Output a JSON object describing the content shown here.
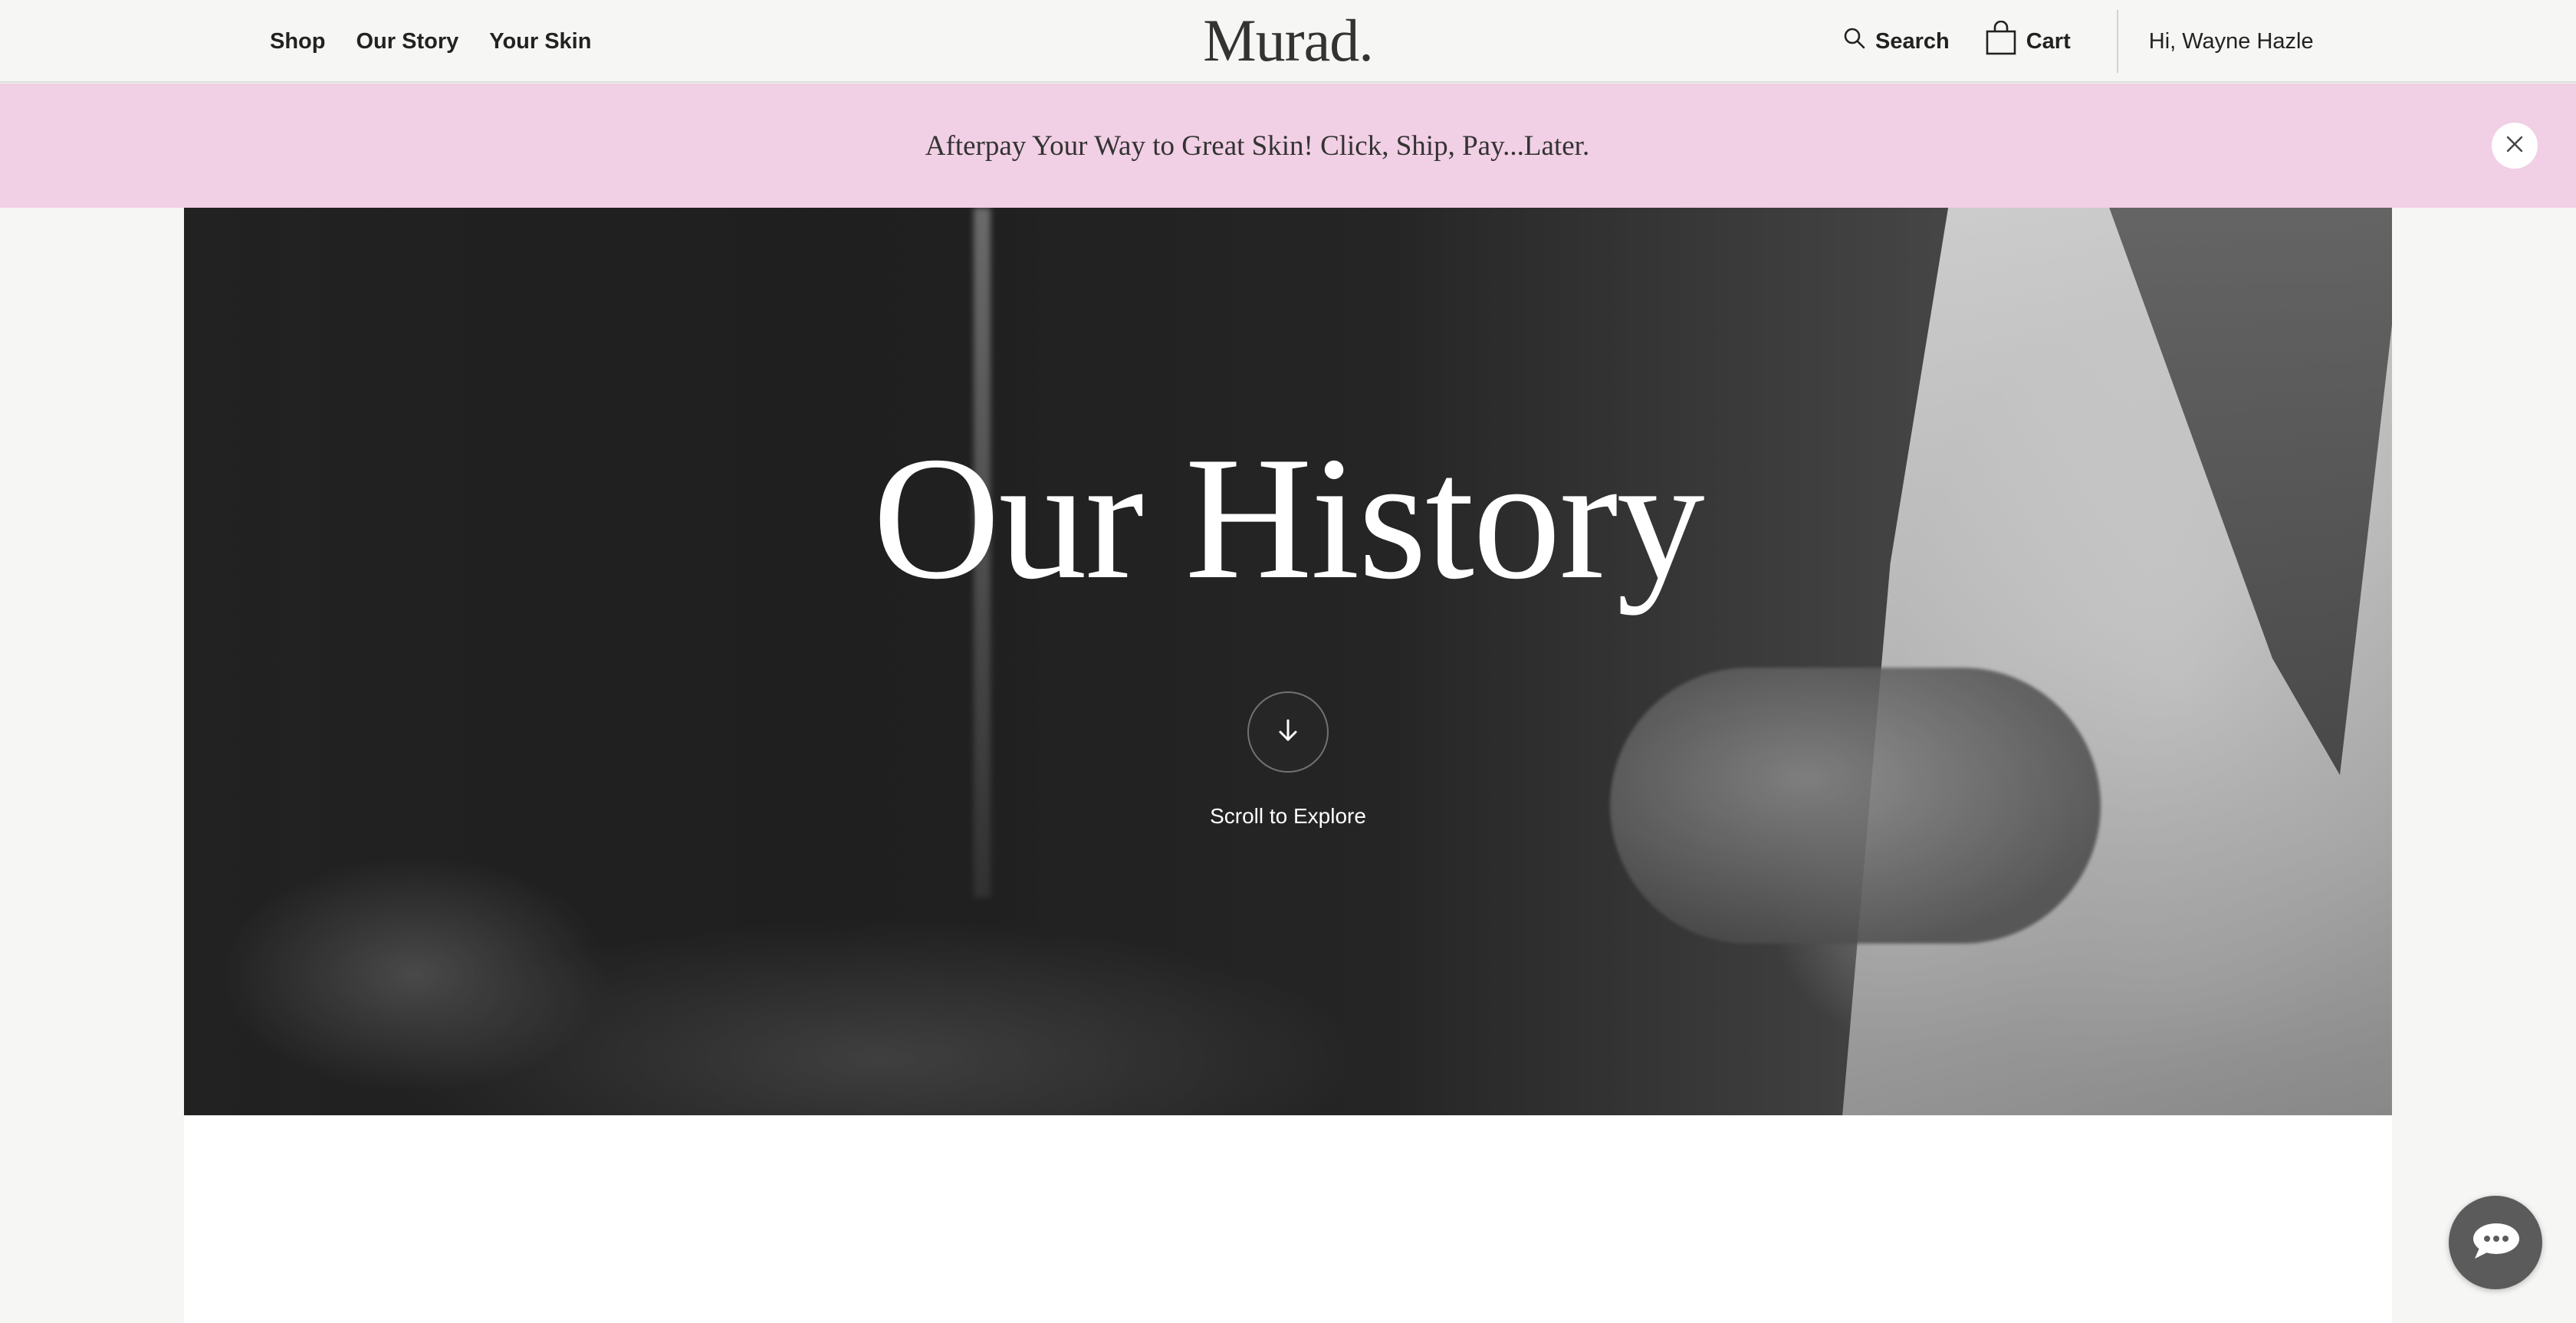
{
  "header": {
    "nav": [
      "Shop",
      "Our Story",
      "Your Skin"
    ],
    "logo": "Murad.",
    "search_label": "Search",
    "cart_label": "Cart",
    "greeting": "Hi, Wayne Hazle"
  },
  "promo": {
    "text": "Afterpay Your Way to Great Skin! Click, Ship, Pay...Later.",
    "background": "#f1cfe5"
  },
  "hero": {
    "title": "Our History",
    "scroll_label": "Scroll to Explore"
  },
  "icons": {
    "search": "search-icon",
    "cart": "shopping-bag-icon",
    "close": "close-icon",
    "scroll": "arrow-down-icon",
    "chat": "chat-bubble-icon"
  }
}
